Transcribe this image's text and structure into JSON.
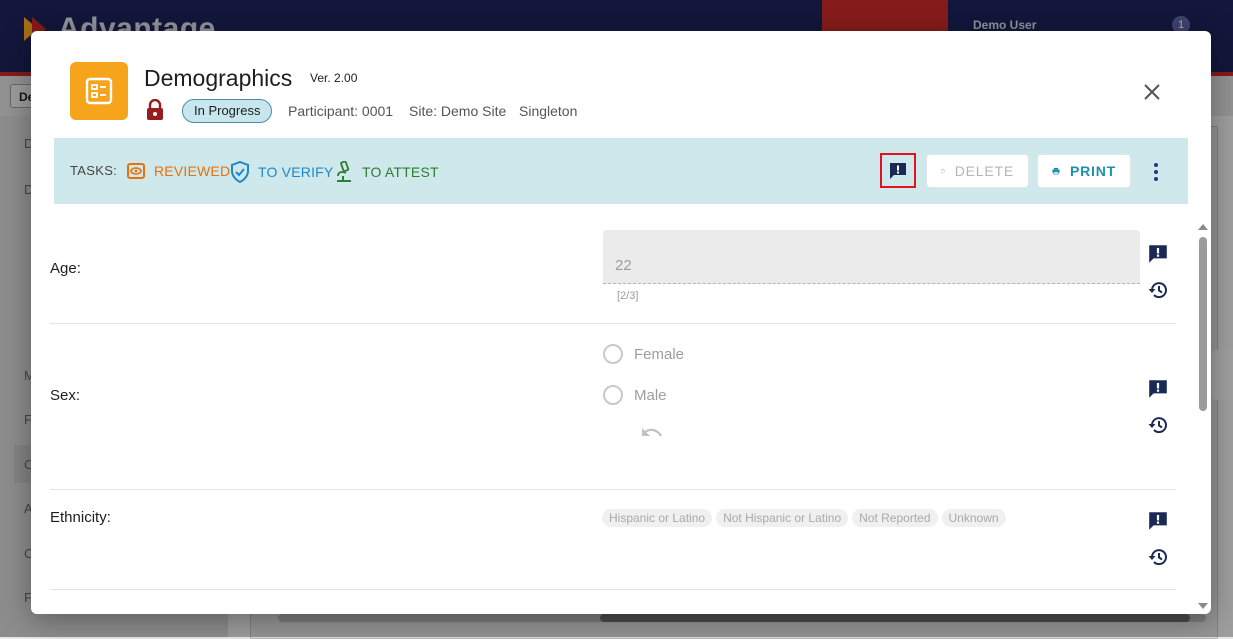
{
  "app": {
    "logo_text": "Advantage",
    "user_name": "Demo User",
    "notification_count": "1",
    "toolbar_chip": "De",
    "sidebar_letters": [
      "D",
      "D",
      "M",
      "F",
      "C",
      "A",
      "C",
      "F"
    ]
  },
  "dialog": {
    "title": "Demographics",
    "version": "Ver. 2.00",
    "status": "In Progress",
    "participant": "Participant: 0001",
    "site": "Site: Demo Site",
    "group": "Singleton",
    "icons": {
      "form": "form-list-icon",
      "lock": "lock-icon",
      "close": "close-icon"
    }
  },
  "tasks": {
    "label": "TASKS:",
    "items": [
      {
        "label": "REVIEWED",
        "icon": "eye-icon",
        "color": "#e8710a"
      },
      {
        "label": "TO VERIFY",
        "icon": "shield-check-icon",
        "color": "#1e88c8"
      },
      {
        "label": "TO ATTEST",
        "icon": "microscope-icon",
        "color": "#2e7d32"
      }
    ],
    "delete_label": "DELETE",
    "print_label": "PRINT"
  },
  "form": {
    "age": {
      "label": "Age:",
      "value": "22",
      "counter": "[2/3]"
    },
    "sex": {
      "label": "Sex:",
      "options": [
        "Female",
        "Male"
      ]
    },
    "ethnicity": {
      "label": "Ethnicity:",
      "options": [
        "Hispanic or Latino",
        "Not Hispanic or Latino",
        "Not Reported",
        "Unknown"
      ]
    }
  },
  "colors": {
    "brand_navy": "#1b2257",
    "accent_orange": "#f7a41d",
    "tasks_bar": "#cfe8ec",
    "highlight_red": "#e0141e"
  }
}
